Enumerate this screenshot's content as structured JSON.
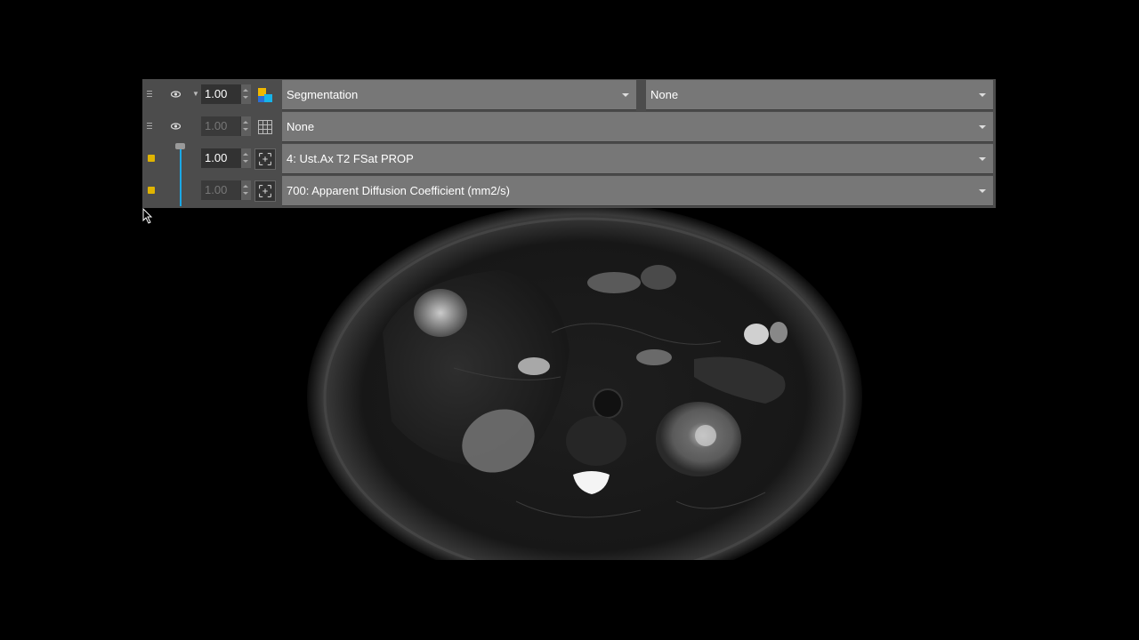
{
  "layers": [
    {
      "opacity": "1.00",
      "opacity_dim": false,
      "label": "Segmentation",
      "secondary": "None",
      "icon": "segmentation-colormap-icon",
      "handle": "grip-icon",
      "visible_icon": "eye-icon"
    },
    {
      "opacity": "1.00",
      "opacity_dim": true,
      "label": "None",
      "icon": "grid-icon",
      "handle": "grip-icon",
      "visible_icon": "eye-icon"
    },
    {
      "opacity": "1.00",
      "opacity_dim": false,
      "label": "4: Ust.Ax T2 FSat PROP",
      "icon": "image-series-icon",
      "handle": "lock-icon"
    },
    {
      "opacity": "1.00",
      "opacity_dim": true,
      "label": "700: Apparent Diffusion Coefficient (mm2/s)",
      "icon": "image-series-icon",
      "handle": "lock-icon"
    }
  ],
  "colors": {
    "panel": "#4c4c4c",
    "dropdown": "#777777",
    "accent": "#1ba8e6",
    "lock": "#e0b400"
  },
  "viewport": {
    "content": "axial MRI abdomen slice",
    "cursor_icon": "pointer-cursor-icon"
  }
}
